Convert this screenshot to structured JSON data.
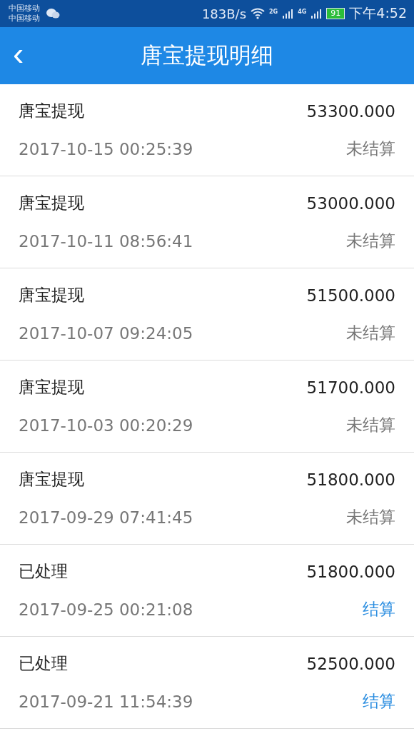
{
  "status_bar": {
    "carriers": [
      "中国移动",
      "中国移动"
    ],
    "speed": "183B/s",
    "network_1": "2G",
    "network_2": "4G",
    "battery": "91",
    "time": "下午4:52"
  },
  "header": {
    "back": "‹",
    "title": "唐宝提现明细"
  },
  "records": [
    {
      "title": "唐宝提现",
      "amount": "53300.000",
      "time": "2017-10-15 00:25:39",
      "status": "未结算",
      "settled": false
    },
    {
      "title": "唐宝提现",
      "amount": "53000.000",
      "time": "2017-10-11 08:56:41",
      "status": "未结算",
      "settled": false
    },
    {
      "title": "唐宝提现",
      "amount": "51500.000",
      "time": "2017-10-07 09:24:05",
      "status": "未结算",
      "settled": false
    },
    {
      "title": "唐宝提现",
      "amount": "51700.000",
      "time": "2017-10-03 00:20:29",
      "status": "未结算",
      "settled": false
    },
    {
      "title": "唐宝提现",
      "amount": "51800.000",
      "time": "2017-09-29 07:41:45",
      "status": "未结算",
      "settled": false
    },
    {
      "title": "已处理",
      "amount": "51800.000",
      "time": "2017-09-25 00:21:08",
      "status": "结算",
      "settled": true
    },
    {
      "title": "已处理",
      "amount": "52500.000",
      "time": "2017-09-21 11:54:39",
      "status": "结算",
      "settled": true
    }
  ]
}
